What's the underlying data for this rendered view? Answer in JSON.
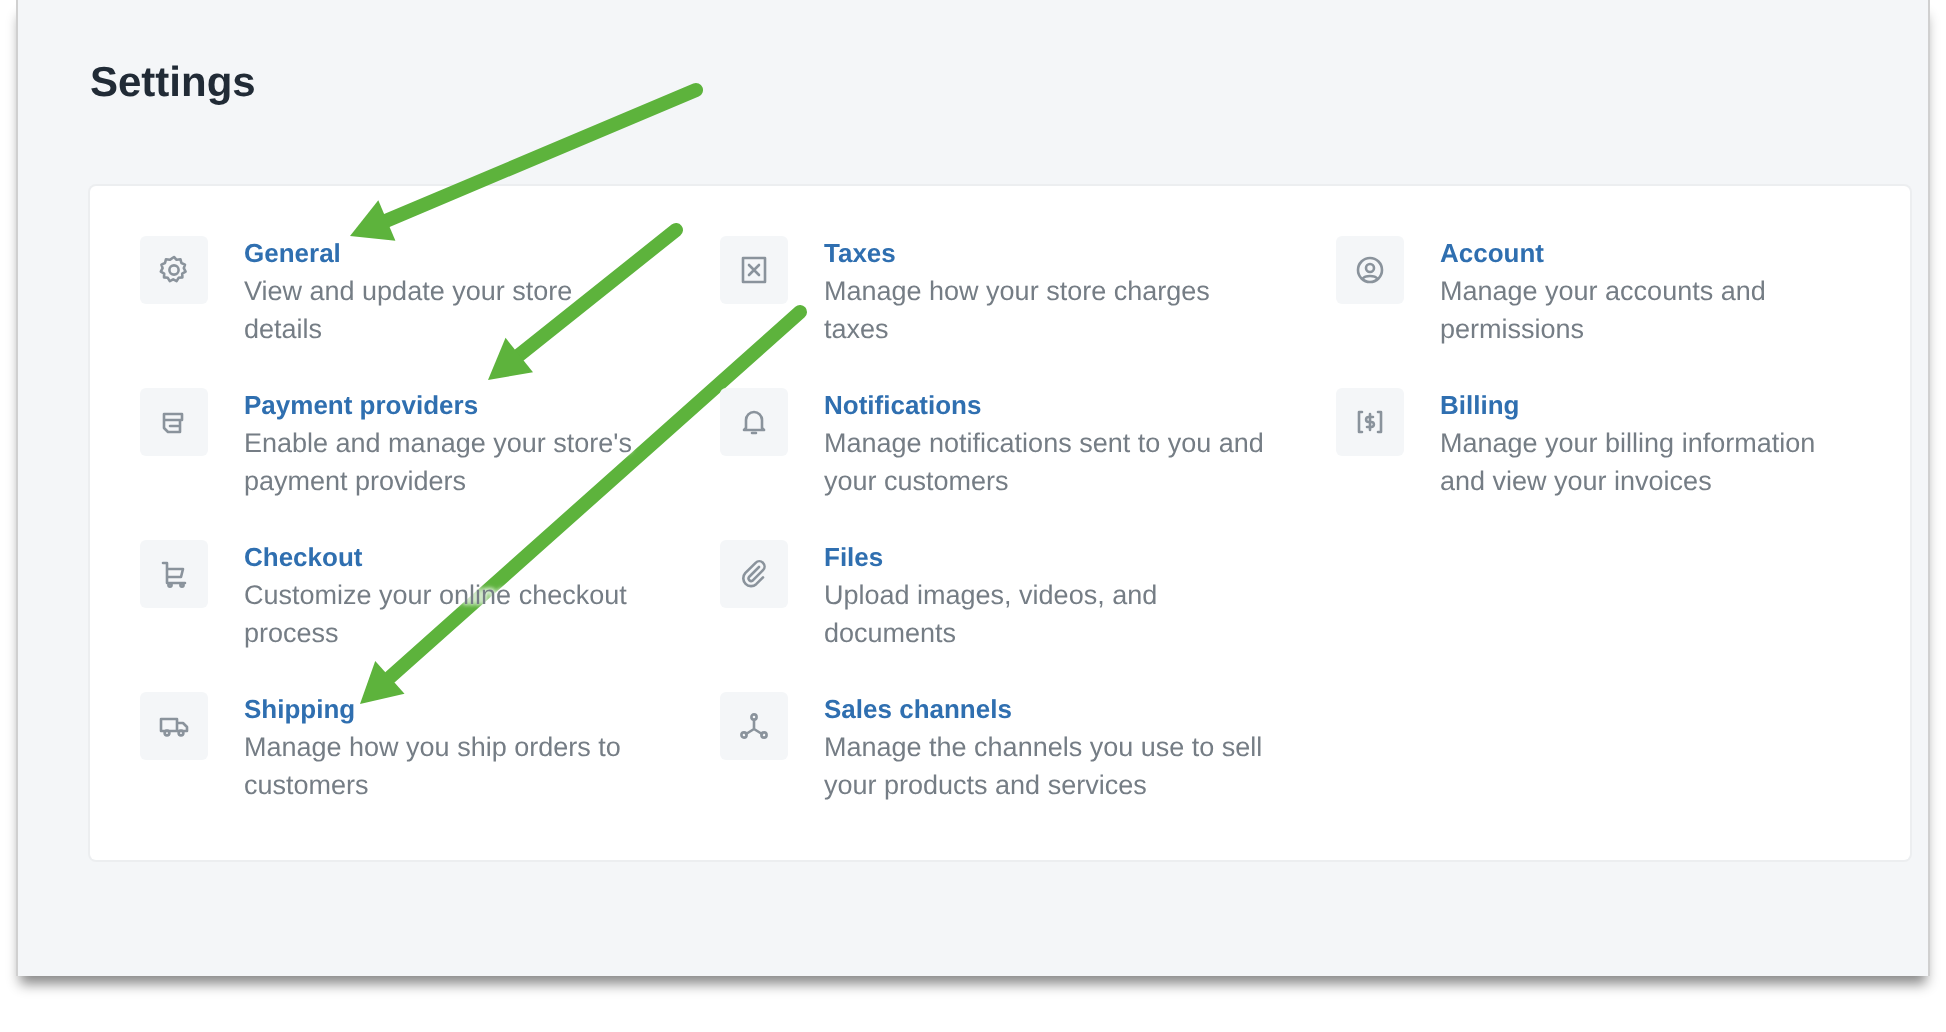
{
  "page": {
    "title": "Settings"
  },
  "settings_items": [
    {
      "title": "General",
      "description": "View and update your store details"
    },
    {
      "title": "Payment providers",
      "description": "Enable and manage your store's payment providers"
    },
    {
      "title": "Checkout",
      "description": "Customize your online checkout process"
    },
    {
      "title": "Shipping",
      "description": "Manage how you ship orders to customers"
    },
    {
      "title": "Taxes",
      "description": "Manage how your store charges taxes"
    },
    {
      "title": "Notifications",
      "description": "Manage notifications sent to you and your customers"
    },
    {
      "title": "Files",
      "description": "Upload images, videos, and documents"
    },
    {
      "title": "Sales channels",
      "description": "Manage the channels you use to sell your products and services"
    },
    {
      "title": "Account",
      "description": "Manage your accounts and permissions"
    },
    {
      "title": "Billing",
      "description": "Manage your billing information and view your invoices"
    }
  ]
}
